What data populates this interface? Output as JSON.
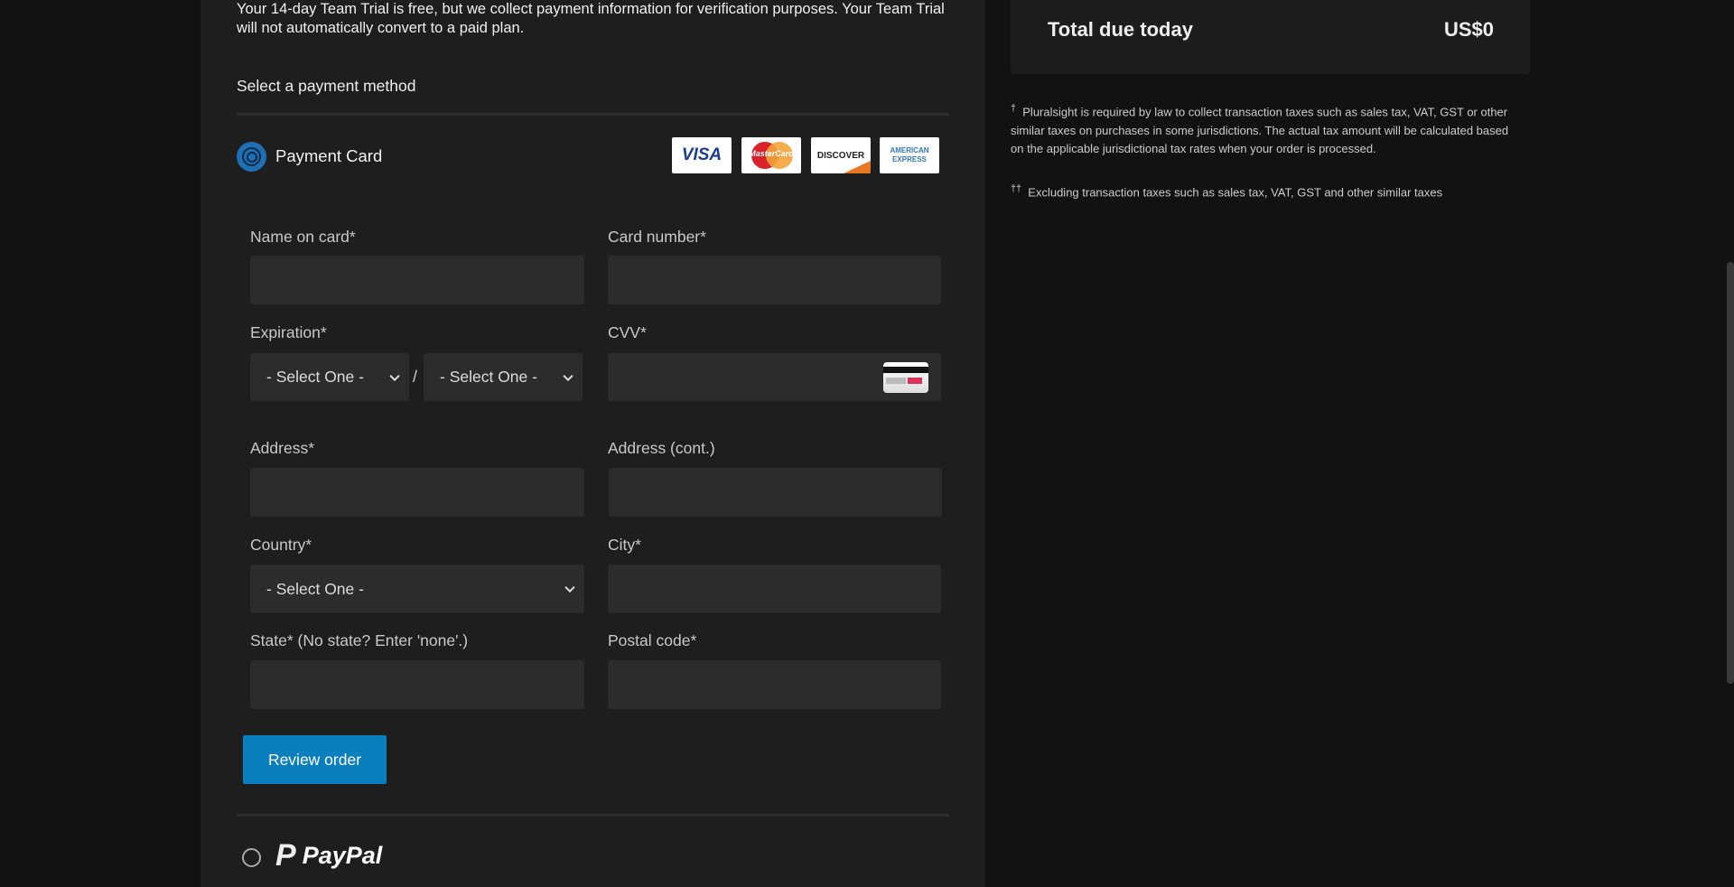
{
  "intro_text": "Your 14-day Team Trial is free, but we collect payment information for verification purposes. Your Team Trial will not automatically convert to a paid plan.",
  "payment_heading": "Select a payment method",
  "payment_card": {
    "label": "Payment Card",
    "selected": true,
    "accepted_cards": [
      "VISA",
      "MasterCard",
      "DISCOVER",
      "AMERICAN EXPRESS"
    ]
  },
  "form": {
    "name_label": "Name on card*",
    "name_value": "",
    "card_number_label": "Card number*",
    "card_number_value": "",
    "expiration_label": "Expiration*",
    "exp_month": "- Select One -",
    "exp_separator": "/",
    "exp_year": "- Select One -",
    "cvv_label": "CVV*",
    "cvv_value": "",
    "address_label": "Address*",
    "address_value": "",
    "address2_label": "Address (cont.)",
    "address2_value": "",
    "country_label": "Country*",
    "country_value": "- Select One -",
    "city_label": "City*",
    "city_value": "",
    "state_label": "State* (No state? Enter 'none'.)",
    "state_value": "",
    "postal_label": "Postal code*",
    "postal_value": "",
    "submit_label": "Review order"
  },
  "paypal": {
    "label": "PayPal",
    "selected": false
  },
  "summary": {
    "total_label": "Total due today",
    "total_value": "US$0"
  },
  "footnotes": [
    {
      "mark": "†",
      "text": "Pluralsight is required by law to collect transaction taxes such as sales tax, VAT, GST or other similar taxes on purchases in some jurisdictions. The actual tax amount will be calculated based on the applicable jurisdictional tax rates when your order is processed."
    },
    {
      "mark": "††",
      "text": "Excluding transaction taxes such as sales tax, VAT, GST and other similar taxes"
    }
  ],
  "colors": {
    "accent": "#0b7ebd",
    "radio": "#1f6fb5",
    "panel": "#1e1e1e",
    "page": "#121212",
    "input": "#2c2c2c"
  }
}
